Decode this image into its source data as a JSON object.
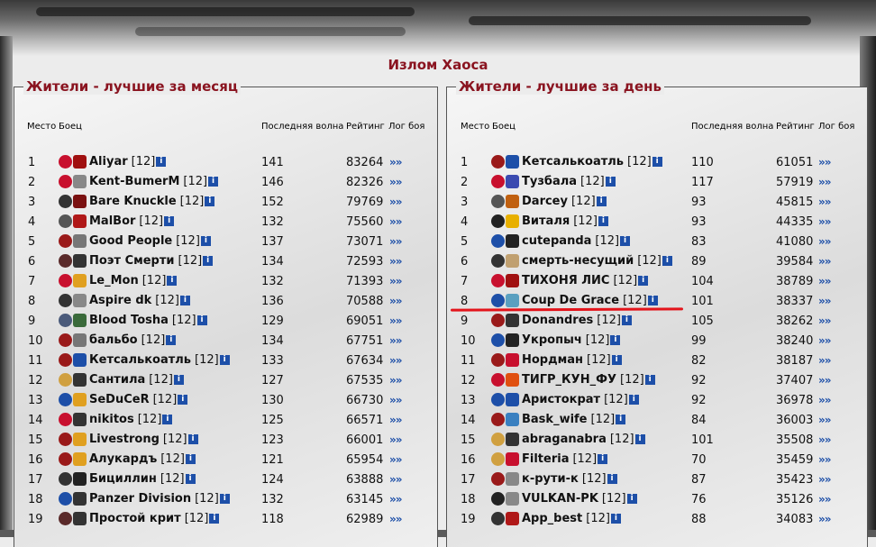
{
  "page_title": "Излом Хаоса",
  "colors": {
    "accent": "#8a1420",
    "info": "#1d4fa8",
    "mark": "#e3141b"
  },
  "columns": {
    "place": "Место",
    "fighter": "Боец",
    "wave": "Последняя волна",
    "rating": "Рейтинг",
    "log": "Лог боя"
  },
  "info_glyph": "i",
  "log_glyph": "»»",
  "month": {
    "title": "Жители - лучшие за месяц",
    "rows": [
      {
        "place": "1",
        "name": "Aliyar",
        "level": "[12]",
        "wave": "141",
        "rating": "83264",
        "icons": [
          "#c8102e",
          "#a01010"
        ]
      },
      {
        "place": "2",
        "name": "Kent-BumerM",
        "level": "[12]",
        "wave": "146",
        "rating": "82326",
        "icons": [
          "#c8102e",
          "#888888"
        ]
      },
      {
        "place": "3",
        "name": "Bare Knuckle",
        "level": "[12]",
        "wave": "152",
        "rating": "79769",
        "icons": [
          "#333333",
          "#7a1010"
        ]
      },
      {
        "place": "4",
        "name": "MalBor",
        "level": "[12]",
        "wave": "132",
        "rating": "75560",
        "icons": [
          "#555555",
          "#b01818"
        ]
      },
      {
        "place": "5",
        "name": "Good People",
        "level": "[12]",
        "wave": "137",
        "rating": "73071",
        "icons": [
          "#9a1a1a",
          "#777777"
        ]
      },
      {
        "place": "6",
        "name": "Поэт Смерти",
        "level": "[12]",
        "wave": "134",
        "rating": "72593",
        "icons": [
          "#5a2a2a",
          "#333333"
        ]
      },
      {
        "place": "7",
        "name": "Le_Mon",
        "level": "[12]",
        "wave": "132",
        "rating": "71393",
        "icons": [
          "#c8102e",
          "#e0a020"
        ]
      },
      {
        "place": "8",
        "name": "Aspire dk",
        "level": "[12]",
        "wave": "136",
        "rating": "70588",
        "icons": [
          "#333333",
          "#888888"
        ]
      },
      {
        "place": "9",
        "name": "Blood Tosha",
        "level": "[12]",
        "wave": "129",
        "rating": "69051",
        "icons": [
          "#4a5a7a",
          "#3a6a3a"
        ]
      },
      {
        "place": "10",
        "name": "бальбо",
        "level": "[12]",
        "wave": "134",
        "rating": "67751",
        "icons": [
          "#9a1a1a",
          "#777777"
        ]
      },
      {
        "place": "11",
        "name": "Кетсалькоатль",
        "level": "[12]",
        "wave": "133",
        "rating": "67634",
        "icons": [
          "#9a1a1a",
          "#1d4fa8"
        ]
      },
      {
        "place": "12",
        "name": "Сантила",
        "level": "[12]",
        "wave": "127",
        "rating": "67535",
        "icons": [
          "#d0a040",
          "#333333"
        ]
      },
      {
        "place": "13",
        "name": "SeDuCeR",
        "level": "[12]",
        "wave": "130",
        "rating": "66730",
        "icons": [
          "#1d4fa8",
          "#e0a020"
        ]
      },
      {
        "place": "14",
        "name": "nikitos",
        "level": "[12]",
        "wave": "125",
        "rating": "66571",
        "icons": [
          "#c8102e",
          "#333333"
        ]
      },
      {
        "place": "15",
        "name": "Livestrong",
        "level": "[12]",
        "wave": "123",
        "rating": "66001",
        "icons": [
          "#9a1a1a",
          "#e0a020"
        ]
      },
      {
        "place": "16",
        "name": "Алукардъ",
        "level": "[12]",
        "wave": "121",
        "rating": "65954",
        "icons": [
          "#9a1a1a",
          "#e0a020"
        ]
      },
      {
        "place": "17",
        "name": "Бициллин",
        "level": "[12]",
        "wave": "124",
        "rating": "63888",
        "icons": [
          "#333333",
          "#222222"
        ]
      },
      {
        "place": "18",
        "name": "Panzer Division",
        "level": "[12]",
        "wave": "132",
        "rating": "63145",
        "icons": [
          "#1d4fa8",
          "#333333"
        ]
      },
      {
        "place": "19",
        "name": "Простой крит",
        "level": "[12]",
        "wave": "118",
        "rating": "62989",
        "icons": [
          "#5a2a2a",
          "#333333"
        ]
      }
    ]
  },
  "day": {
    "title": "Жители - лучшие за день",
    "rows": [
      {
        "place": "1",
        "name": "Кетсалькоатль",
        "level": "[12]",
        "wave": "110",
        "rating": "61051",
        "icons": [
          "#9a1a1a",
          "#1d4fa8"
        ]
      },
      {
        "place": "2",
        "name": "Тузбала",
        "level": "[12]",
        "wave": "117",
        "rating": "57919",
        "icons": [
          "#c8102e",
          "#3a4ab0"
        ]
      },
      {
        "place": "3",
        "name": "Darcey",
        "level": "[12]",
        "wave": "93",
        "rating": "45815",
        "icons": [
          "#555555",
          "#c06010"
        ]
      },
      {
        "place": "4",
        "name": "Виталя",
        "level": "[12]",
        "wave": "93",
        "rating": "44335",
        "icons": [
          "#222222",
          "#e8b000"
        ]
      },
      {
        "place": "5",
        "name": "cutepanda",
        "level": "[12]",
        "wave": "83",
        "rating": "41080",
        "icons": [
          "#1d4fa8",
          "#222222"
        ]
      },
      {
        "place": "6",
        "name": "смерть-несущий",
        "level": "[12]",
        "wave": "89",
        "rating": "39584",
        "icons": [
          "#333333",
          "#c0a070"
        ]
      },
      {
        "place": "7",
        "name": "ТИХОНЯ ЛИС",
        "level": "[12]",
        "wave": "104",
        "rating": "38789",
        "icons": [
          "#c8102e",
          "#a01010"
        ]
      },
      {
        "place": "8",
        "name": "Coup De Grace",
        "level": "[12]",
        "wave": "101",
        "rating": "38337",
        "icons": [
          "#1d4fa8",
          "#5aa0c0"
        ]
      },
      {
        "place": "9",
        "name": "Donandres",
        "level": "[12]",
        "wave": "105",
        "rating": "38262",
        "icons": [
          "#9a1a1a",
          "#333333"
        ]
      },
      {
        "place": "10",
        "name": "Укропыч",
        "level": "[12]",
        "wave": "99",
        "rating": "38240",
        "icons": [
          "#1d4fa8",
          "#222222"
        ]
      },
      {
        "place": "11",
        "name": "Нордман",
        "level": "[12]",
        "wave": "82",
        "rating": "38187",
        "icons": [
          "#9a1a1a",
          "#c8102e"
        ]
      },
      {
        "place": "12",
        "name": "ТИГР_КУН_ФУ",
        "level": "[12]",
        "wave": "92",
        "rating": "37407",
        "icons": [
          "#c8102e",
          "#e05010"
        ]
      },
      {
        "place": "13",
        "name": "Аристократ",
        "level": "[12]",
        "wave": "92",
        "rating": "36978",
        "icons": [
          "#1d4fa8",
          "#1d4fa8"
        ]
      },
      {
        "place": "14",
        "name": "Bask_wife",
        "level": "[12]",
        "wave": "84",
        "rating": "36003",
        "icons": [
          "#9a1a1a",
          "#3a80c0"
        ]
      },
      {
        "place": "15",
        "name": "abraganabra",
        "level": "[12]",
        "wave": "101",
        "rating": "35508",
        "icons": [
          "#d0a040",
          "#333333"
        ]
      },
      {
        "place": "16",
        "name": "Filteria",
        "level": "[12]",
        "wave": "70",
        "rating": "35459",
        "icons": [
          "#d0a040",
          "#c8102e"
        ]
      },
      {
        "place": "17",
        "name": "к-рути-к",
        "level": "[12]",
        "wave": "87",
        "rating": "35423",
        "icons": [
          "#9a1a1a",
          "#888888"
        ]
      },
      {
        "place": "18",
        "name": "VULKAN-PK",
        "level": "[12]",
        "wave": "76",
        "rating": "35126",
        "icons": [
          "#222222",
          "#888888"
        ]
      },
      {
        "place": "19",
        "name": "App_best",
        "level": "[12]",
        "wave": "88",
        "rating": "34083",
        "icons": [
          "#333333",
          "#b01818"
        ]
      }
    ]
  }
}
